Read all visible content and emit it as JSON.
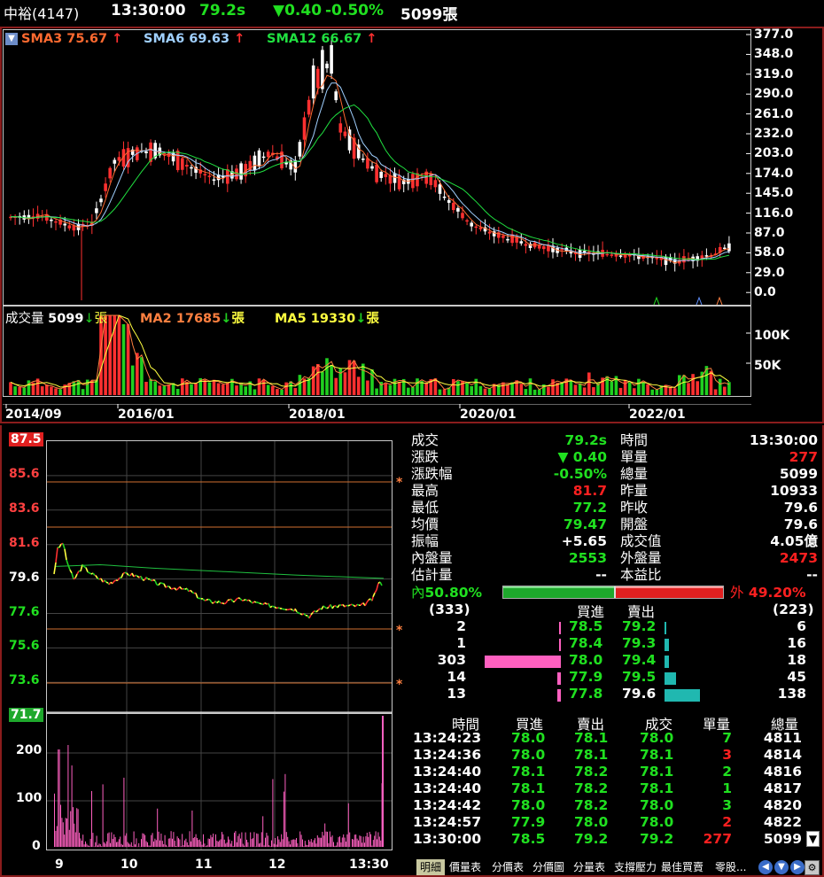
{
  "header": {
    "stock_name": "中裕(4147)",
    "time": "13:30:00",
    "price": "79.2s",
    "change": "▼0.40",
    "change_pct": "-0.50%",
    "volume": "5099張"
  },
  "kchart": {
    "menu_glyph": "▼",
    "sma3": "SMA3 75.67",
    "sma6": "SMA6 69.63",
    "sma12": "SMA12 66.67",
    "up_arrow": "↑",
    "yticks": [
      "377.0",
      "348.0",
      "319.0",
      "290.0",
      "261.0",
      "232.0",
      "203.0",
      "174.0",
      "145.0",
      "116.0",
      "87.0",
      "58.0",
      "29.0",
      "0.0"
    ],
    "vol_label": "成交量",
    "vol_value": "5099",
    "vol_unit": "張",
    "down_arrow": "↓",
    "ma2": "MA2 17685",
    "ma5": "MA5 19330",
    "vol_yticks": [
      "100K",
      "50K"
    ],
    "dates": [
      "2014/09",
      "2016/01",
      "2018/01",
      "2020/01",
      "2022/01"
    ]
  },
  "intraday": {
    "price_ticks": [
      "87.5",
      "85.6",
      "83.6",
      "81.6",
      "79.6",
      "77.6",
      "75.6",
      "73.6",
      "71.7"
    ],
    "vol_ticks": [
      "200",
      "100",
      "0"
    ],
    "time_ticks": [
      "9",
      "10",
      "11",
      "12",
      "13:30"
    ],
    "star": "*"
  },
  "quote": {
    "left": [
      {
        "label": "成交",
        "value": "79.2s",
        "color": "gr"
      },
      {
        "label": "漲跌",
        "value": "▼  0.40",
        "color": "gr"
      },
      {
        "label": "漲跌幅",
        "value": "-0.50%",
        "color": "gr"
      },
      {
        "label": "最高",
        "value": "81.7",
        "color": "rd"
      },
      {
        "label": "最低",
        "value": "77.2",
        "color": "gr"
      },
      {
        "label": "均價",
        "value": "79.47",
        "color": "gr"
      },
      {
        "label": "振幅",
        "value": "+5.65",
        "color": "wh"
      },
      {
        "label": "內盤量",
        "value": "2553",
        "color": "gr"
      },
      {
        "label": "估計量",
        "value": "--",
        "color": "wh"
      }
    ],
    "right": [
      {
        "label": "時間",
        "value": "13:30:00",
        "color": "wh"
      },
      {
        "label": "單量",
        "value": "277",
        "color": "rd"
      },
      {
        "label": "總量",
        "value": "5099",
        "color": "wh"
      },
      {
        "label": "昨量",
        "value": "10933",
        "color": "wh"
      },
      {
        "label": "昨收",
        "value": "79.6",
        "color": "wh"
      },
      {
        "label": "開盤",
        "value": "79.6",
        "color": "wh"
      },
      {
        "label": "成交值",
        "value": "4.05億",
        "color": "wh"
      },
      {
        "label": "外盤量",
        "value": "2473",
        "color": "rd"
      },
      {
        "label": "本益比",
        "value": "--",
        "color": "wh"
      }
    ],
    "inner_label": "內",
    "inner_pct": "50.80%",
    "outer_label": "外",
    "outer_pct": "49.20%",
    "inner_ratio": 0.508
  },
  "book": {
    "bid_total": "(333)",
    "buy_header": "買進",
    "sell_header": "賣出",
    "ask_total": "(223)",
    "rows": [
      {
        "bid_vol": "2",
        "bid": "78.5",
        "ask": "79.2",
        "ask_vol": "6",
        "bid_n": 2,
        "ask_n": 6
      },
      {
        "bid_vol": "1",
        "bid": "78.4",
        "ask": "79.3",
        "ask_vol": "16",
        "bid_n": 1,
        "ask_n": 16
      },
      {
        "bid_vol": "303",
        "bid": "78.0",
        "ask": "79.4",
        "ask_vol": "18",
        "bid_n": 303,
        "ask_n": 18
      },
      {
        "bid_vol": "14",
        "bid": "77.9",
        "ask": "79.5",
        "ask_vol": "45",
        "bid_n": 14,
        "ask_n": 45
      },
      {
        "bid_vol": "13",
        "bid": "77.8",
        "ask": "79.6",
        "ask_vol": "138",
        "bid_n": 13,
        "ask_n": 138
      }
    ]
  },
  "ticks": {
    "headers": [
      "時間",
      "買進",
      "賣出",
      "成交",
      "單量",
      "總量"
    ],
    "rows": [
      {
        "time": "13:24:23",
        "bid": "78.0",
        "ask": "78.1",
        "price": "78.0",
        "vol": "7",
        "total": "4811",
        "vc": "gr"
      },
      {
        "time": "13:24:36",
        "bid": "78.0",
        "ask": "78.1",
        "price": "78.1",
        "vol": "3",
        "total": "4814",
        "vc": "rd"
      },
      {
        "time": "13:24:40",
        "bid": "78.1",
        "ask": "78.2",
        "price": "78.1",
        "vol": "2",
        "total": "4816",
        "vc": "gr"
      },
      {
        "time": "13:24:40",
        "bid": "78.1",
        "ask": "78.2",
        "price": "78.1",
        "vol": "1",
        "total": "4817",
        "vc": "gr"
      },
      {
        "time": "13:24:42",
        "bid": "78.0",
        "ask": "78.2",
        "price": "78.0",
        "vol": "3",
        "total": "4820",
        "vc": "gr"
      },
      {
        "time": "13:24:57",
        "bid": "77.9",
        "ask": "78.0",
        "price": "78.0",
        "vol": "2",
        "total": "4822",
        "vc": "rd"
      },
      {
        "time": "13:30:00",
        "bid": "78.5",
        "ask": "79.2",
        "price": "79.2",
        "vol": "277",
        "total": "5099",
        "vc": "rd"
      }
    ]
  },
  "tabs": [
    "明細",
    "價量表",
    "分價表",
    "分價圖",
    "分量表",
    "支撐壓力",
    "最佳買賣",
    "零股..."
  ],
  "colors": {
    "up": "#ff3030",
    "down": "#20d020",
    "sma3": "#ff6a30",
    "sma6": "#a0d0ff",
    "sma12": "#20e040",
    "ma5": "#ffff40",
    "pink": "#ff60c0",
    "teal": "#20b8b0"
  }
}
